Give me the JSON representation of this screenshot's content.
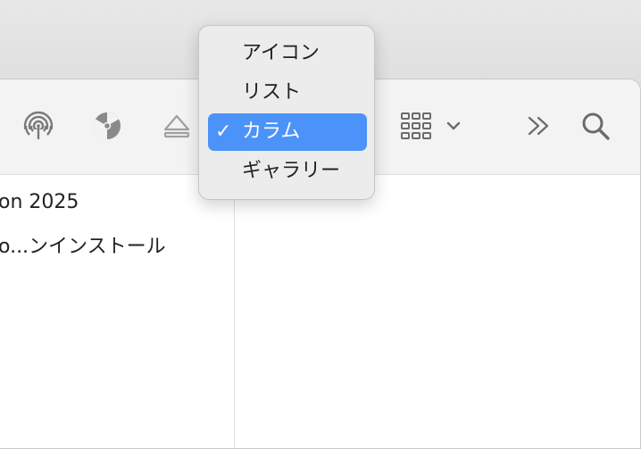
{
  "toolbar": {
    "icons": [
      "airdrop-icon",
      "burn-icon",
      "eject-icon",
      "view-grid-icon",
      "chevron-down-icon",
      "more-chevrons-icon",
      "search-icon"
    ]
  },
  "view_menu": {
    "items": [
      {
        "label": "アイコン",
        "selected": false
      },
      {
        "label": "リスト",
        "selected": false
      },
      {
        "label": "カラム",
        "selected": true
      },
      {
        "label": "ギャラリー",
        "selected": false
      }
    ],
    "checkmark": "✓"
  },
  "file_list": {
    "rows": [
      "on 2025",
      "o...ンインストール"
    ]
  },
  "colors": {
    "selection": "#4b93f8",
    "menu_bg": "#ececec",
    "toolbar_bg": "#f3f3f3"
  }
}
